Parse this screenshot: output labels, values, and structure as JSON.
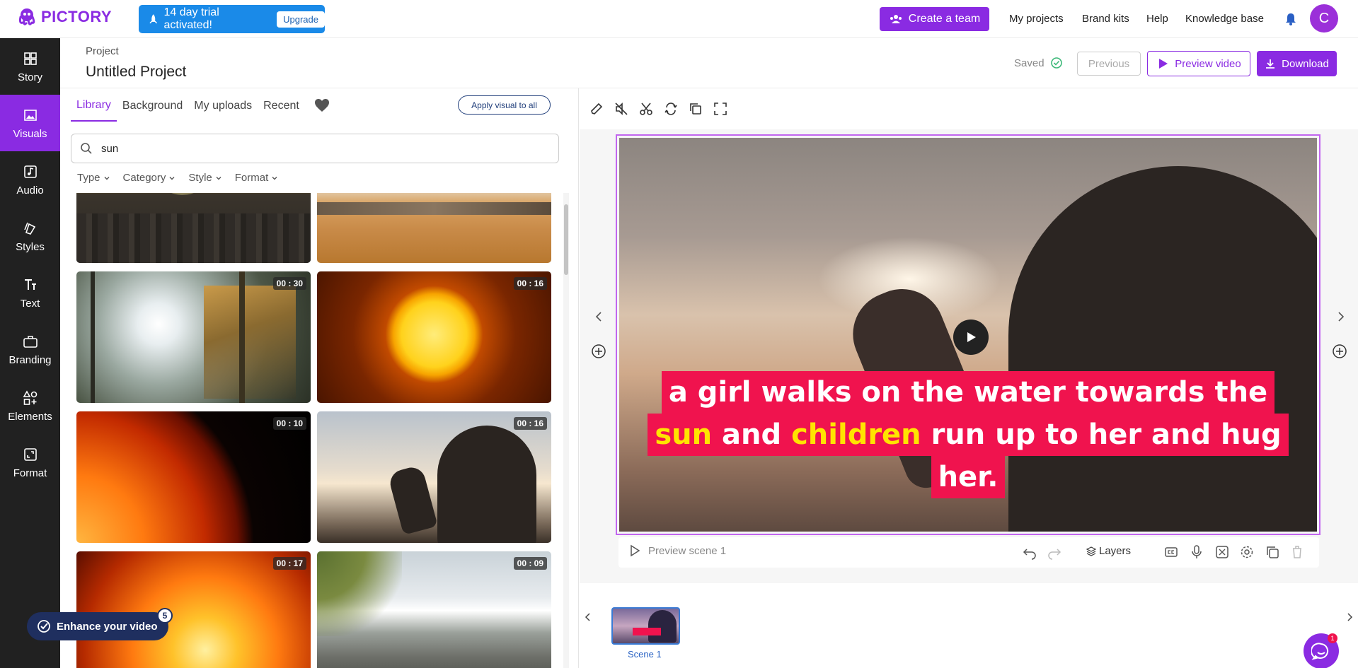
{
  "app": {
    "name": "PICTORY"
  },
  "trial": {
    "text": "14 day trial activated!",
    "upgrade_label": "Upgrade"
  },
  "top_nav": {
    "create_team": "Create a team",
    "links": [
      "My projects",
      "Brand kits",
      "Help",
      "Knowledge base"
    ],
    "avatar_initial": "C"
  },
  "sidebar": {
    "items": [
      {
        "label": "Story",
        "icon": "story-icon"
      },
      {
        "label": "Visuals",
        "icon": "visuals-icon",
        "active": true
      },
      {
        "label": "Audio",
        "icon": "audio-icon"
      },
      {
        "label": "Styles",
        "icon": "styles-icon"
      },
      {
        "label": "Text",
        "icon": "text-icon"
      },
      {
        "label": "Branding",
        "icon": "branding-icon"
      },
      {
        "label": "Elements",
        "icon": "elements-icon"
      },
      {
        "label": "Format",
        "icon": "format-icon"
      }
    ],
    "enhance_label": "Enhance your video",
    "enhance_count": "5"
  },
  "project": {
    "label": "Project",
    "title": "Untitled Project",
    "saved": "Saved",
    "previous": "Previous",
    "preview_video": "Preview video",
    "download": "Download"
  },
  "library": {
    "tabs": [
      "Library",
      "Background",
      "My uploads",
      "Recent"
    ],
    "active_tab": "Library",
    "apply_label": "Apply visual to all",
    "search_value": "sun",
    "filters": [
      "Type",
      "Category",
      "Style",
      "Format"
    ],
    "thumbnails": [
      {
        "duration": "",
        "scene": "city-sunset"
      },
      {
        "duration": "",
        "scene": "desert-sunset"
      },
      {
        "duration": "00 : 30",
        "scene": "forest-sunrays"
      },
      {
        "duration": "00 : 16",
        "scene": "sun-disk"
      },
      {
        "duration": "00 : 10",
        "scene": "solar-surface"
      },
      {
        "duration": "00 : 16",
        "scene": "girl-hand-silhouette"
      },
      {
        "duration": "00 : 17",
        "scene": "solar-flare"
      },
      {
        "duration": "00 : 09",
        "scene": "frosty-field-sun"
      }
    ]
  },
  "editor": {
    "caption": {
      "line1": "a girl walks on the water towards the",
      "line2_hl1": "sun",
      "line2_mid": " and ",
      "line2_hl2": "children",
      "line2_end": " run up to her and hug",
      "line3": "her."
    },
    "preview_scene": "Preview scene 1",
    "layers": "Layers",
    "scene_label": "Scene 1",
    "chat_badge": "1"
  },
  "colors": {
    "accent": "#8a2be2",
    "caption_bg": "#f0134e",
    "caption_highlight": "#ffe400",
    "sidebar_bg": "#212121"
  }
}
